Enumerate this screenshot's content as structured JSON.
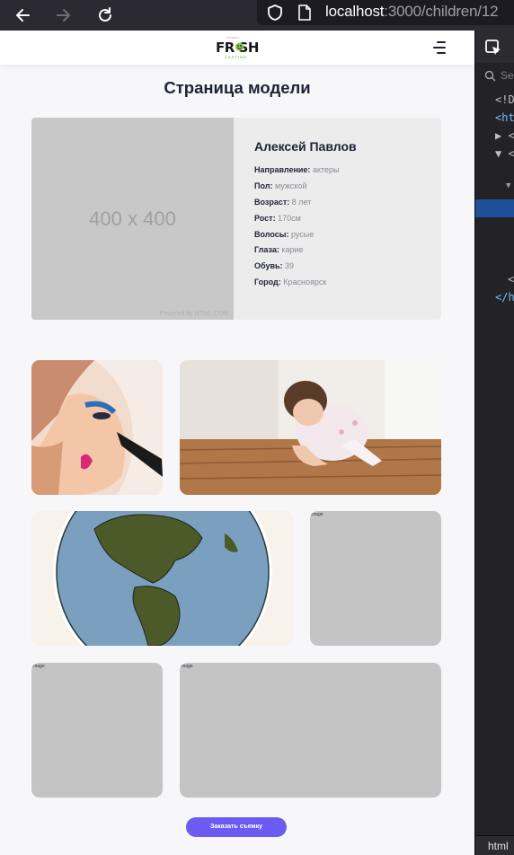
{
  "browser": {
    "url_host": "localhost",
    "url_path": ":3000/children/12"
  },
  "header": {
    "logo_text": "FR SH",
    "logo_sub": "CASTING",
    "logo_top": "ПРОЕКТ"
  },
  "page": {
    "title": "Страница модели"
  },
  "model": {
    "photo_placeholder": "400 x 400",
    "photo_footer": "Powered by HTML.COM",
    "name": "Алексей Павлов",
    "attributes": [
      {
        "key": "Направление:",
        "value": "актеры"
      },
      {
        "key": "Пол:",
        "value": "мужской"
      },
      {
        "key": "Возраст:",
        "value": "8 лет"
      },
      {
        "key": "Рост:",
        "value": "170см"
      },
      {
        "key": "Волосы:",
        "value": "русые"
      },
      {
        "key": "Глаза:",
        "value": "карие"
      },
      {
        "key": "Обувь:",
        "value": "39"
      },
      {
        "key": "Город:",
        "value": "Красноярск"
      }
    ]
  },
  "gallery": {
    "broken_image_label": "image"
  },
  "actions": {
    "order_label": "Заказать съемку"
  },
  "devtools": {
    "search_placeholder": "Se",
    "lines": [
      "<!D",
      "<ht",
      "▶ <",
      "▼ <",
      "▼",
      "<",
      "</h"
    ],
    "footer_tab": "html"
  },
  "colors": {
    "accent": "#6a5cf0",
    "page_bg": "#f7f7fa",
    "card_bg": "#ececec",
    "placeholder": "#c4c4c4"
  }
}
